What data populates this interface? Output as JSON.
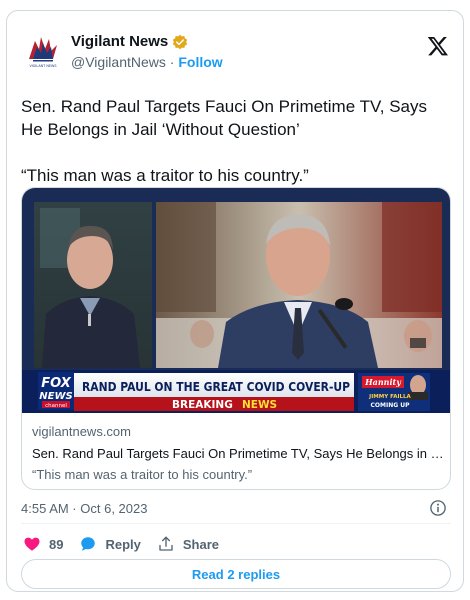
{
  "account": {
    "name": "Vigilant News",
    "handle": "@VigilantNews",
    "separator": " · ",
    "follow_label": "Follow",
    "avatar_text": "VIGILANT NEWS"
  },
  "tweet": {
    "text_line1": "Sen. Rand Paul Targets Fauci On Primetime TV, Says He Belongs in Jail ‘Without Question’",
    "text_quote": "“This man was a traitor to his country.”"
  },
  "media": {
    "logo_top": "FOX",
    "logo_bottom": "NEWS",
    "logo_sub": "channel",
    "headline": "RAND PAUL ON THE GREAT COVID COVER-UP",
    "breaking_1": "BREAKING",
    "breaking_2": "NEWS",
    "show_name": "Hannity",
    "promo_name": "JIMMY FAILLA",
    "promo_sub": "COMING UP"
  },
  "link": {
    "domain": "vigilantnews.com",
    "title": "Sen. Rand Paul Targets Fauci On Primetime TV, Says He Belongs in Ja...",
    "description": "“This man was a traitor to his country.”"
  },
  "meta": {
    "timestamp": "4:55 AM · Oct 6, 2023"
  },
  "actions": {
    "like_count": "89",
    "reply_label": "Reply",
    "share_label": "Share"
  },
  "replies_button": "Read 2 replies",
  "colors": {
    "accent": "#1d9bf0",
    "like": "#f91880",
    "verified": "#e2a81c"
  }
}
